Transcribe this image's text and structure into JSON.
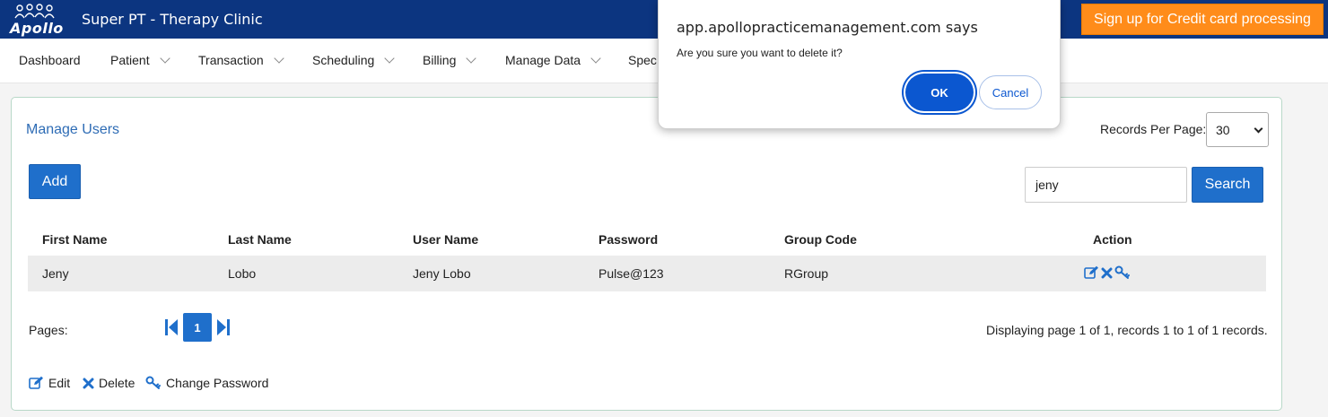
{
  "header": {
    "logo_text": "Apollo",
    "clinic_name": "Super PT - Therapy Clinic",
    "signup_label": "Sign up for Credit card processing",
    "brand_color": "#0c3580",
    "accent_color": "#ff8c1a"
  },
  "menu": {
    "items": [
      {
        "label": "Dashboard",
        "has_dropdown": false
      },
      {
        "label": "Patient",
        "has_dropdown": true
      },
      {
        "label": "Transaction",
        "has_dropdown": true
      },
      {
        "label": "Scheduling",
        "has_dropdown": true
      },
      {
        "label": "Billing",
        "has_dropdown": true
      },
      {
        "label": "Manage Data",
        "has_dropdown": true
      },
      {
        "label": "Spec",
        "has_dropdown": false
      }
    ]
  },
  "panel": {
    "title": "Manage Users",
    "records_per_page_label": "Records Per Page:",
    "records_per_page_value": "30",
    "add_label": "Add",
    "search_value": "jeny",
    "search_label": "Search"
  },
  "table": {
    "headers": [
      "First Name",
      "Last Name",
      "User Name",
      "Password",
      "Group Code",
      "Action"
    ],
    "rows": [
      {
        "first_name": "Jeny",
        "last_name": "Lobo",
        "user_name": "Jeny Lobo",
        "password": "Pulse@123",
        "group_code": "RGroup",
        "actions": [
          "edit-icon",
          "delete-icon",
          "key-icon"
        ]
      }
    ]
  },
  "pagination": {
    "pages_label": "Pages:",
    "current_page": "1",
    "display_info": "Displaying page 1 of 1, records 1 to 1 of 1 records."
  },
  "legend": {
    "edit": "Edit",
    "delete": "Delete",
    "change_password": "Change Password"
  },
  "dialog": {
    "title": "app.apollopracticemanagement.com says",
    "message": "Are you sure you want to delete it?",
    "ok_label": "OK",
    "cancel_label": "Cancel"
  },
  "colors": {
    "link_blue": "#2e6cb5",
    "button_blue": "#1f6fcb",
    "dialog_blue": "#0b57d0"
  }
}
